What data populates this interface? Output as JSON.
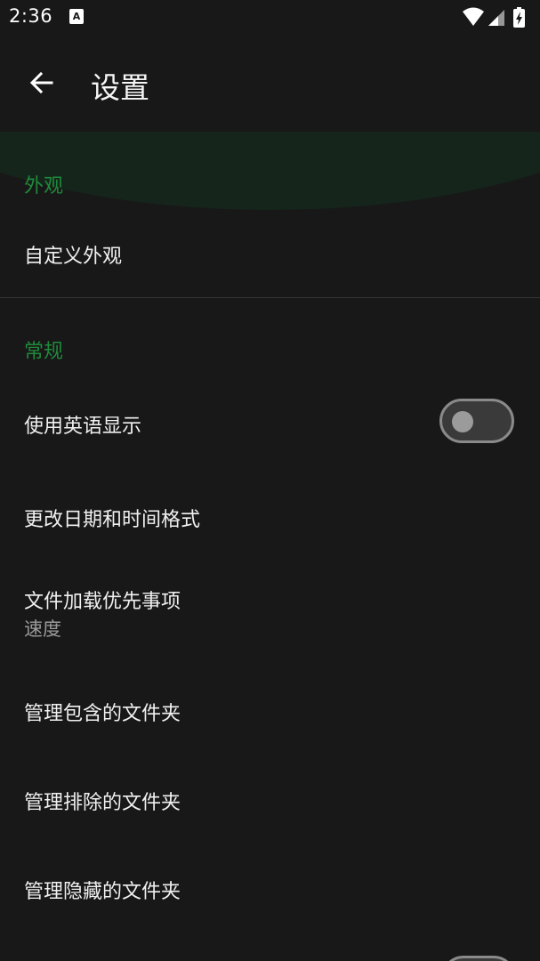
{
  "status_bar": {
    "time": "2:36",
    "notification_icon": "A",
    "icons": [
      "wifi-icon",
      "signal-icon",
      "battery-charging-icon"
    ]
  },
  "app_bar": {
    "back_icon": "arrow-left-icon",
    "title": "设置"
  },
  "sections": {
    "appearance": {
      "header": "外观",
      "items": {
        "customize": {
          "title": "自定义外观"
        }
      }
    },
    "general": {
      "header": "常规",
      "items": {
        "use_english": {
          "title": "使用英语显示",
          "toggle": "off"
        },
        "date_time_format": {
          "title": "更改日期和时间格式"
        },
        "file_loading_priority": {
          "title": "文件加载优先事项",
          "value": "速度"
        },
        "included_folders": {
          "title": "管理包含的文件夹"
        },
        "excluded_folders": {
          "title": "管理排除的文件夹"
        },
        "hidden_folders": {
          "title": "管理隐藏的文件夹"
        }
      }
    }
  },
  "colors": {
    "background": "#181818",
    "accent_green": "#1f8a3b",
    "arc_green": "#15251b",
    "primary_text": "#f0f0f0",
    "secondary_text": "#9a9a9a"
  }
}
